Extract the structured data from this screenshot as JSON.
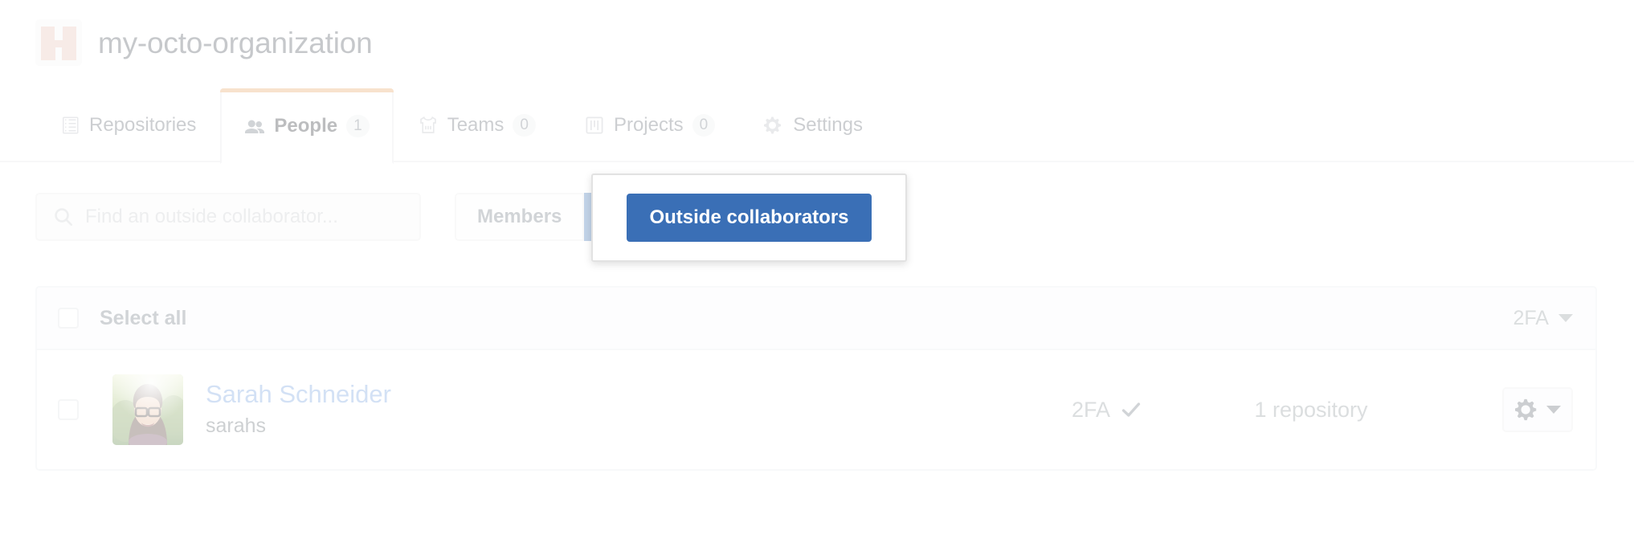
{
  "org": {
    "name": "my-octo-organization",
    "avatar_icon": "octo-org-logo"
  },
  "tabs": [
    {
      "label": "Repositories",
      "icon": "repo-icon",
      "count": null,
      "selected": false
    },
    {
      "label": "People",
      "icon": "people-icon",
      "count": "1",
      "selected": true
    },
    {
      "label": "Teams",
      "icon": "jersey-icon",
      "count": "0",
      "selected": false
    },
    {
      "label": "Projects",
      "icon": "project-icon",
      "count": "0",
      "selected": false
    },
    {
      "label": "Settings",
      "icon": "gear-icon",
      "count": null,
      "selected": false
    }
  ],
  "filter": {
    "search_placeholder": "Find an outside collaborator...",
    "search_value": "",
    "search_icon": "search-icon",
    "members_label": "Members",
    "outside_collaborators_label": "Outside collaborators",
    "active_button": "Outside collaborators",
    "accent_color": "#3a6fb6"
  },
  "highlight": {
    "target": "Outside collaborators",
    "label": "Outside collaborators"
  },
  "list": {
    "header": {
      "select_all_label": "Select all",
      "twofa_filter_label": "2FA",
      "twofa_filter_icon": "chevron-down-icon"
    },
    "rows": [
      {
        "full_name": "Sarah Schneider",
        "login": "sarahs",
        "twofa_label": "2FA",
        "twofa_enabled_icon": "check-icon",
        "repositories": "1 repository",
        "actions_icon": "gear-icon",
        "actions_caret_icon": "chevron-down-icon",
        "selected": false
      }
    ]
  }
}
